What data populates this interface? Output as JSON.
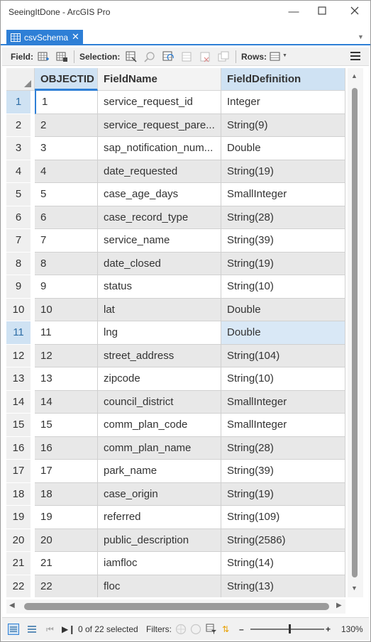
{
  "window": {
    "title": "SeeingItDone - ArcGIS Pro"
  },
  "tab": {
    "label": "csvSchema"
  },
  "toolbar": {
    "field_label": "Field:",
    "selection_label": "Selection:",
    "rows_label": "Rows:"
  },
  "columns": [
    "OBJECTID",
    "FieldName",
    "FieldDefinition"
  ],
  "rows": [
    {
      "n": "1",
      "id": "1",
      "name": "service_request_id",
      "def": "Integer"
    },
    {
      "n": "2",
      "id": "2",
      "name": "service_request_pare...",
      "def": "String(9)"
    },
    {
      "n": "3",
      "id": "3",
      "name": "sap_notification_num...",
      "def": "Double"
    },
    {
      "n": "4",
      "id": "4",
      "name": "date_requested",
      "def": "String(19)"
    },
    {
      "n": "5",
      "id": "5",
      "name": "case_age_days",
      "def": "SmallInteger"
    },
    {
      "n": "6",
      "id": "6",
      "name": "case_record_type",
      "def": "String(28)"
    },
    {
      "n": "7",
      "id": "7",
      "name": "service_name",
      "def": "String(39)"
    },
    {
      "n": "8",
      "id": "8",
      "name": "date_closed",
      "def": "String(19)"
    },
    {
      "n": "9",
      "id": "9",
      "name": "status",
      "def": "String(10)"
    },
    {
      "n": "10",
      "id": "10",
      "name": "lat",
      "def": "Double"
    },
    {
      "n": "11",
      "id": "11",
      "name": "lng",
      "def": "Double"
    },
    {
      "n": "12",
      "id": "12",
      "name": "street_address",
      "def": "String(104)"
    },
    {
      "n": "13",
      "id": "13",
      "name": "zipcode",
      "def": "String(10)"
    },
    {
      "n": "14",
      "id": "14",
      "name": "council_district",
      "def": "SmallInteger"
    },
    {
      "n": "15",
      "id": "15",
      "name": "comm_plan_code",
      "def": "SmallInteger"
    },
    {
      "n": "16",
      "id": "16",
      "name": "comm_plan_name",
      "def": "String(28)"
    },
    {
      "n": "17",
      "id": "17",
      "name": "park_name",
      "def": "String(39)"
    },
    {
      "n": "18",
      "id": "18",
      "name": "case_origin",
      "def": "String(19)"
    },
    {
      "n": "19",
      "id": "19",
      "name": "referred",
      "def": "String(109)"
    },
    {
      "n": "20",
      "id": "20",
      "name": "public_description",
      "def": "String(2586)"
    },
    {
      "n": "21",
      "id": "21",
      "name": "iamfloc",
      "def": "String(14)"
    },
    {
      "n": "22",
      "id": "22",
      "name": "floc",
      "def": "String(13)"
    }
  ],
  "status": {
    "selection_text": "0 of 22 selected",
    "filters_label": "Filters:",
    "zoom_text": "130%",
    "zoom_level_percent": 130
  },
  "colors": {
    "accent": "#2e7fd6",
    "header_selected": "#cfe2f3"
  }
}
